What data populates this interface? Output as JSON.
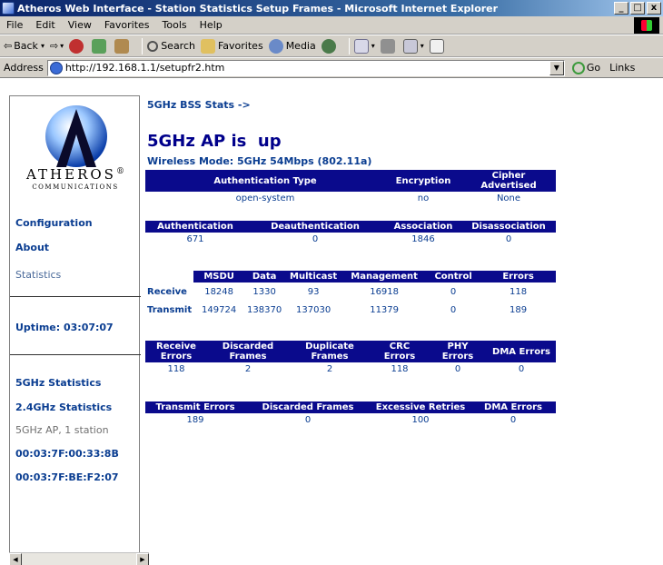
{
  "window": {
    "title": "Atheros Web Interface - Station Statistics Setup Frames - Microsoft Internet Explorer",
    "buttons": [
      "_",
      "□",
      "x"
    ]
  },
  "menu": [
    "File",
    "Edit",
    "View",
    "Favorites",
    "Tools",
    "Help"
  ],
  "toolbar": {
    "back": "Back",
    "search": "Search",
    "favorites": "Favorites",
    "media": "Media"
  },
  "address": {
    "label": "Address",
    "url": "http://192.168.1.1/setupfr2.htm",
    "go": "Go",
    "links": "Links"
  },
  "sidebar": {
    "brand": "ATHEROS",
    "brand_mark": "®",
    "brand_sub": "COMMUNICATIONS",
    "nav": {
      "configuration": "Configuration",
      "about": "About",
      "statistics": "Statistics"
    },
    "uptime": "Uptime: 03:07:07",
    "stats": {
      "ghz5": "5GHz Statistics",
      "ghz24": "2.4GHz Statistics",
      "ap_station": "5GHz AP, 1 station",
      "mac1": "00:03:7F:00:33:8B",
      "mac2": "00:03:7F:BE:F2:07"
    }
  },
  "main": {
    "crumb": "5GHz BSS Stats ->",
    "status": "5GHz AP is  up",
    "mode": "Wireless Mode: 5GHz 54Mbps (802.11a)",
    "auth_table": {
      "headers": [
        "Authentication Type",
        "Encryption",
        "Cipher Advertised"
      ],
      "row": [
        "open-system",
        "no",
        "None"
      ]
    },
    "assoc_table": {
      "headers": [
        "Authentication",
        "Deauthentication",
        "Association",
        "Disassociation"
      ],
      "row": [
        "671",
        "0",
        "1846",
        "0"
      ]
    },
    "frames_table": {
      "headers": [
        "",
        "MSDU",
        "Data",
        "Multicast",
        "Management",
        "Control",
        "Errors"
      ],
      "rows": [
        [
          "Receive",
          "18248",
          "1330",
          "93",
          "16918",
          "0",
          "118"
        ],
        [
          "Transmit",
          "149724",
          "138370",
          "137030",
          "11379",
          "0",
          "189"
        ]
      ]
    },
    "rx_errors_table": {
      "headers": [
        "Receive Errors",
        "Discarded Frames",
        "Duplicate Frames",
        "CRC Errors",
        "PHY Errors",
        "DMA Errors"
      ],
      "row": [
        "118",
        "2",
        "2",
        "118",
        "0",
        "0"
      ]
    },
    "tx_errors_table": {
      "headers": [
        "Transmit Errors",
        "Discarded Frames",
        "Excessive Retries",
        "DMA Errors"
      ],
      "row": [
        "189",
        "0",
        "100",
        "0"
      ]
    }
  }
}
